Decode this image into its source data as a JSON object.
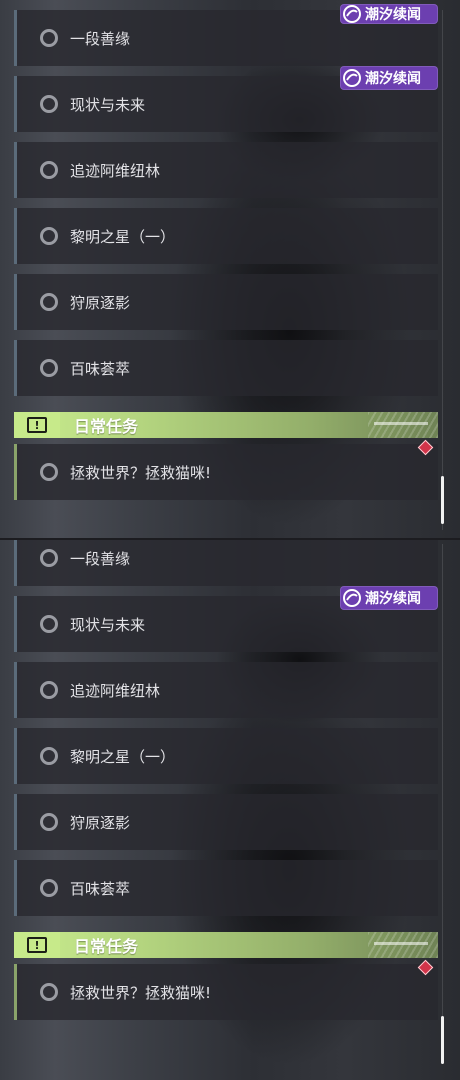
{
  "watermark": "潮汐续闻",
  "quests": [
    {
      "label": "一段善缘"
    },
    {
      "label": "现状与未来"
    },
    {
      "label": "追迹阿维纽林"
    },
    {
      "label": "黎明之星（一）"
    },
    {
      "label": "狩原逐影"
    },
    {
      "label": "百味荟萃"
    }
  ],
  "daily_header": "日常任务",
  "daily_icon_glyph": "!",
  "daily_quests": [
    {
      "label": "拯救世界？拯救猫咪!"
    }
  ],
  "colors": {
    "header_green": "#c9ec8e",
    "badge_purple": "#6c3fb0",
    "alert_red": "#d2344a"
  }
}
